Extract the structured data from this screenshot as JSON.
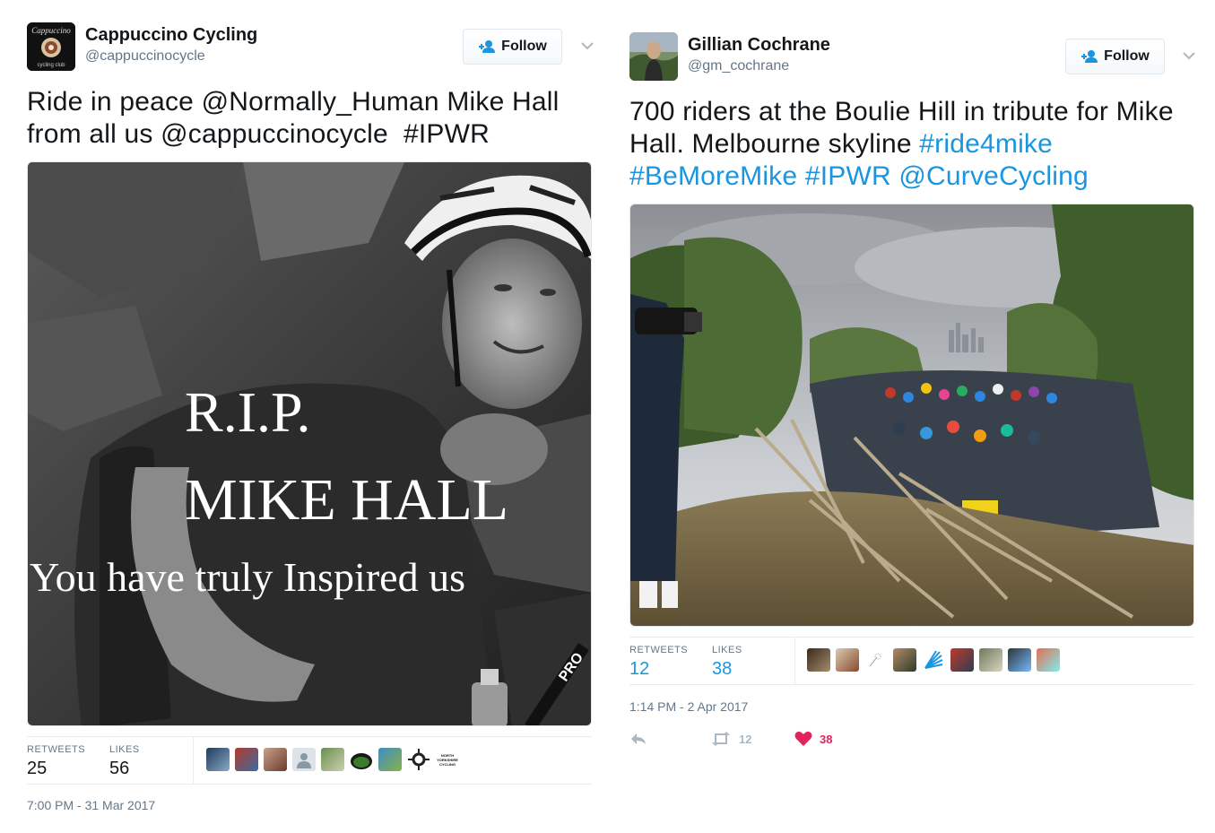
{
  "left": {
    "display_name": "Cappuccino Cycling",
    "handle": "@cappuccinocycle",
    "avatar_text_top": "Cappuccino",
    "avatar_text_bottom": "cycling club",
    "follow_label": "Follow",
    "text_plain_1": "Ride in peace ",
    "text_mention_1": "@Normally_Human",
    "text_plain_2": " Mike Hall from all us ",
    "text_mention_2": "@cappuccinocycle",
    "text_plain_3": "  ",
    "text_hashtag_1": "#IPWR",
    "image_text_line1": "R.I.P.",
    "image_text_line2": "MIKE HALL",
    "image_text_line3": "You have truly Inspired us",
    "retweets_label": "RETWEETS",
    "retweets_value": "25",
    "likes_label": "LIKES",
    "likes_value": "56",
    "liker_logo_text": "NORTH YORKSHIRE CYCLING",
    "timestamp": "7:00 PM - 31 Mar 2017"
  },
  "right": {
    "display_name": "Gillian Cochrane",
    "handle": "@gm_cochrane",
    "follow_label": "Follow",
    "text_plain_1": "700 riders at the Boulie Hill in tribute for Mike Hall. Melbourne skyline ",
    "text_hashtag_1": "#ride4mike",
    "text_hashtag_2": "#BeMoreMike",
    "text_hashtag_3": "#IPWR",
    "text_mention_1": "@CurveCycling",
    "retweets_label": "RETWEETS",
    "retweets_value": "12",
    "likes_label": "LIKES",
    "likes_value": "38",
    "timestamp": "1:14 PM - 2 Apr 2017",
    "retweet_count": "12",
    "like_count": "38"
  },
  "colors": {
    "link": "#1b95e0",
    "muted": "#657786",
    "like_red": "#e0245e",
    "border": "#e6ecf0"
  }
}
